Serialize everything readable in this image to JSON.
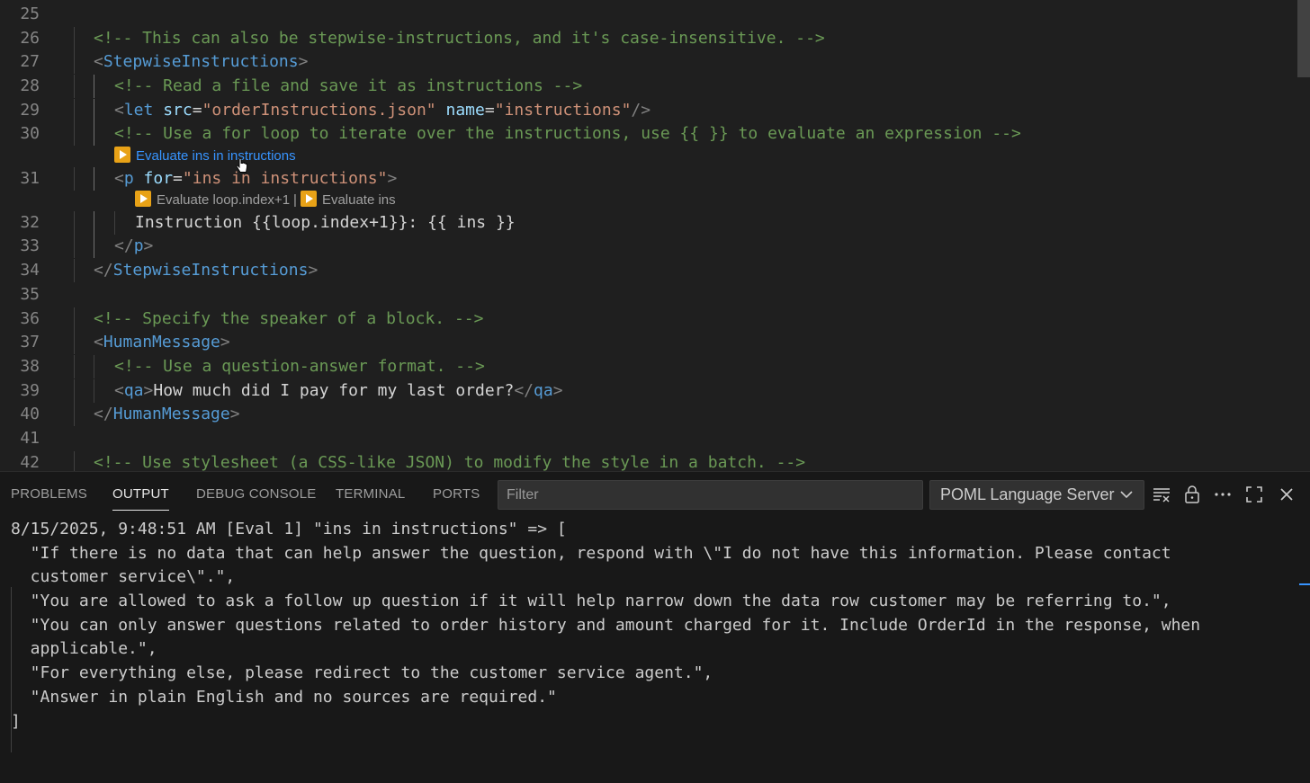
{
  "editor": {
    "lines": [
      {
        "num": "25",
        "segments": []
      },
      {
        "num": "26",
        "segments": [
          {
            "t": "<!-- This can also be stepwise-instructions, and it's case-insensitive. -->",
            "c": "c-comment"
          }
        ]
      },
      {
        "num": "27",
        "segments": [
          {
            "t": "<",
            "c": "c-punct"
          },
          {
            "t": "StepwiseInstructions",
            "c": "c-tag"
          },
          {
            "t": ">",
            "c": "c-punct"
          }
        ]
      },
      {
        "num": "28",
        "segments": [
          {
            "t": "<!-- Read a file and save it as instructions -->",
            "c": "c-comment"
          }
        ]
      },
      {
        "num": "29",
        "segments": [
          {
            "t": "<",
            "c": "c-punct"
          },
          {
            "t": "let",
            "c": "c-tag"
          },
          {
            "t": " src",
            "c": "c-attr"
          },
          {
            "t": "=",
            "c": "c-text"
          },
          {
            "t": "\"orderInstructions.json\"",
            "c": "c-str"
          },
          {
            "t": " name",
            "c": "c-attr"
          },
          {
            "t": "=",
            "c": "c-text"
          },
          {
            "t": "\"instructions\"",
            "c": "c-str"
          },
          {
            "t": "/>",
            "c": "c-punct"
          }
        ]
      },
      {
        "num": "30",
        "segments": [
          {
            "t": "<!-- Use a for loop to iterate over the instructions, use {{ }} to evaluate an expression -->",
            "c": "c-comment"
          }
        ]
      },
      {
        "num": "31",
        "segments": [
          {
            "t": "<",
            "c": "c-punct"
          },
          {
            "t": "p",
            "c": "c-tag"
          },
          {
            "t": " for",
            "c": "c-attr"
          },
          {
            "t": "=",
            "c": "c-text"
          },
          {
            "t": "\"ins in instructions\"",
            "c": "c-str"
          },
          {
            "t": ">",
            "c": "c-punct"
          }
        ]
      },
      {
        "num": "32",
        "segments": [
          {
            "t": "Instruction {{loop.index+1}}: {{ ins }}",
            "c": "c-text"
          }
        ]
      },
      {
        "num": "33",
        "segments": [
          {
            "t": "</",
            "c": "c-punct"
          },
          {
            "t": "p",
            "c": "c-tag"
          },
          {
            "t": ">",
            "c": "c-punct"
          }
        ]
      },
      {
        "num": "34",
        "segments": [
          {
            "t": "</",
            "c": "c-punct"
          },
          {
            "t": "StepwiseInstructions",
            "c": "c-tag"
          },
          {
            "t": ">",
            "c": "c-punct"
          }
        ]
      },
      {
        "num": "35",
        "segments": []
      },
      {
        "num": "36",
        "segments": [
          {
            "t": "<!-- Specify the speaker of a block. -->",
            "c": "c-comment"
          }
        ]
      },
      {
        "num": "37",
        "segments": [
          {
            "t": "<",
            "c": "c-punct"
          },
          {
            "t": "HumanMessage",
            "c": "c-tag"
          },
          {
            "t": ">",
            "c": "c-punct"
          }
        ]
      },
      {
        "num": "38",
        "segments": [
          {
            "t": "<!-- Use a question-answer format. -->",
            "c": "c-comment"
          }
        ]
      },
      {
        "num": "39",
        "segments": [
          {
            "t": "<",
            "c": "c-punct"
          },
          {
            "t": "qa",
            "c": "c-tag"
          },
          {
            "t": ">",
            "c": "c-punct"
          },
          {
            "t": "How much did I pay for my last order?",
            "c": "c-text"
          },
          {
            "t": "</",
            "c": "c-punct"
          },
          {
            "t": "qa",
            "c": "c-tag"
          },
          {
            "t": ">",
            "c": "c-punct"
          }
        ]
      },
      {
        "num": "40",
        "segments": [
          {
            "t": "</",
            "c": "c-punct"
          },
          {
            "t": "HumanMessage",
            "c": "c-tag"
          },
          {
            "t": ">",
            "c": "c-punct"
          }
        ]
      },
      {
        "num": "41",
        "segments": []
      },
      {
        "num": "42",
        "segments": [
          {
            "t": "<!-- Use stylesheet (a CSS-like JSON) to modify the style in a batch. -->",
            "c": "c-comment"
          }
        ]
      }
    ],
    "codelens": {
      "line31": "Evaluate ins in instructions",
      "line32_a": "Evaluate loop.index+1",
      "line32_sep": "|",
      "line32_b": "Evaluate ins"
    }
  },
  "panel": {
    "tabs": {
      "problems": "PROBLEMS",
      "output": "OUTPUT",
      "debug_console": "DEBUG CONSOLE",
      "terminal": "TERMINAL",
      "ports": "PORTS"
    },
    "filter_placeholder": "Filter",
    "channel": "POML Language Server",
    "output_lines": [
      "8/15/2025, 9:48:51 AM [Eval 1] \"ins in instructions\" => [",
      "  \"If there is no data that can help answer the question, respond with \\\"I do not have this information. Please contact",
      "  customer service\\\".\",",
      "  \"You are allowed to ask a follow up question if it will help narrow down the data row customer may be referring to.\",",
      "  \"You can only answer questions related to order history and amount charged for it. Include OrderId in the response, when",
      "  applicable.\",",
      "  \"For everything else, please redirect to the customer service agent.\",",
      "  \"Answer in plain English and no sources are required.\"",
      "]"
    ]
  }
}
